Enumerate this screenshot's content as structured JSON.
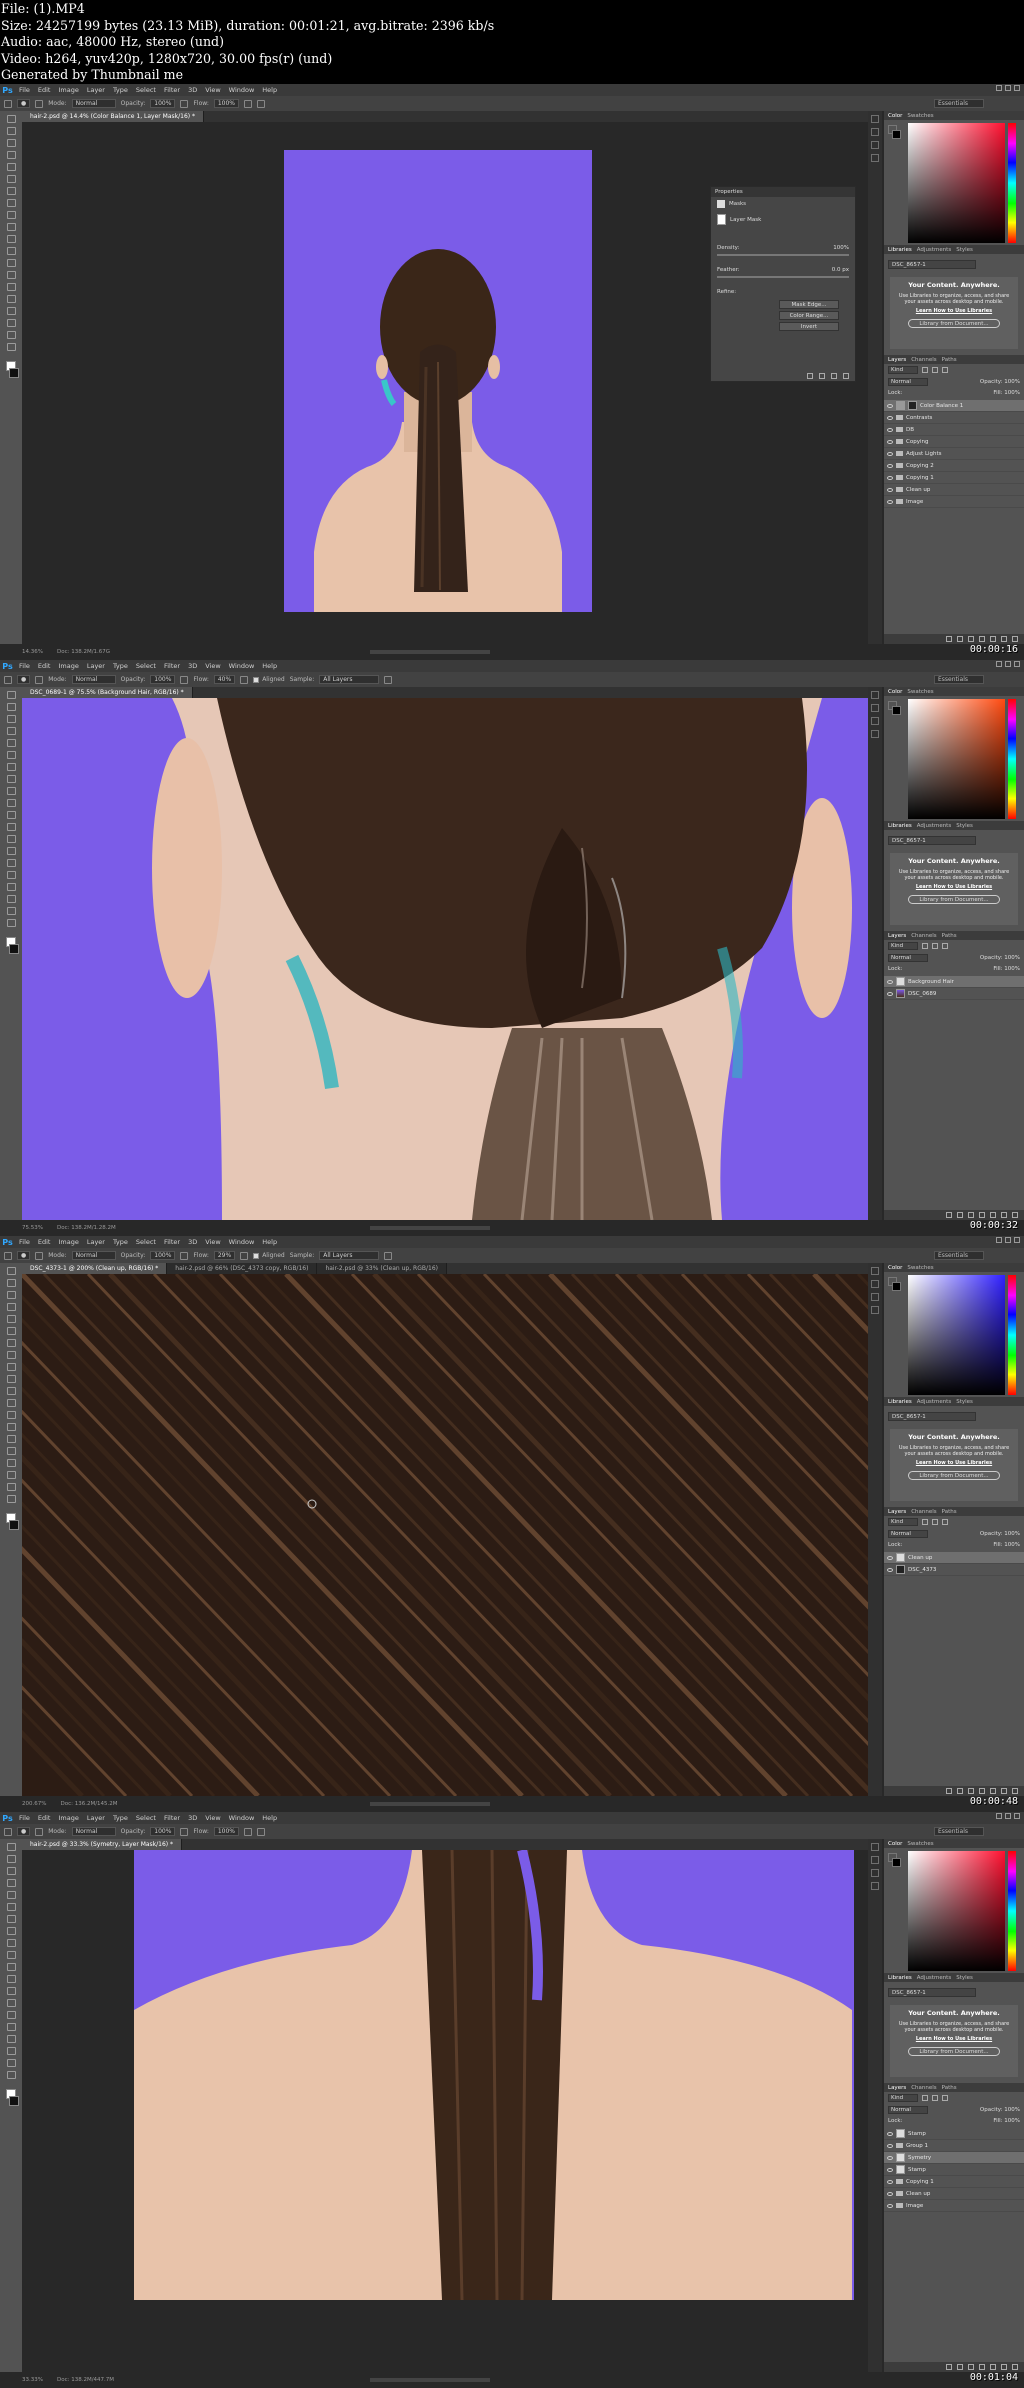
{
  "header": {
    "file": "File:  (1).MP4",
    "size": "Size: 24257199 bytes (23.13 MiB), duration: 00:01:21, avg.bitrate: 2396 kb/s",
    "audio": "Audio: aac, 48000 Hz, stereo (und)",
    "video": "Video: h264, yuv420p, 1280x720, 30.00 fps(r) (und)",
    "generated": "Generated by Thumbnail me"
  },
  "app": {
    "logo": "Ps",
    "menu": [
      "File",
      "Edit",
      "Image",
      "Layer",
      "Type",
      "Select",
      "Filter",
      "3D",
      "View",
      "Window",
      "Help"
    ],
    "workspace": "Essentials"
  },
  "frames": [
    {
      "timecode": "00:00:16",
      "tabs": [
        "hair-2.psd @ 14.4% (Color Balance 1, Layer Mask/16) *"
      ],
      "options": {
        "mode_label": "Mode:",
        "mode": "Normal",
        "opacity_label": "Opacity:",
        "opacity": "100%",
        "flow_label": "Flow:",
        "flow": "100%"
      },
      "status": [
        "14.36%",
        "Doc: 138.2M/1.67G"
      ],
      "color_tabs": [
        "Color",
        "Swatches"
      ],
      "libraries": {
        "tabs": [
          "Libraries",
          "Adjustments",
          "Styles"
        ],
        "selected": "DSC_8657-1",
        "title": "Your Content. Anywhere.",
        "text": "Use Libraries to organize, access, and share your assets across desktop and mobile.",
        "link": "Learn How to Use Libraries",
        "button": "Library from Document..."
      },
      "layer_tabs": [
        "Layers",
        "Channels",
        "Paths"
      ],
      "kind": "Kind",
      "blend": "Normal",
      "opacity": "Opacity: 100%",
      "fill": "Fill: 100%",
      "layers": [
        {
          "name": "Color Balance 1",
          "type": "adj",
          "selected": true
        },
        {
          "name": "Contrasts",
          "type": "group"
        },
        {
          "name": "DB",
          "type": "group"
        },
        {
          "name": "Copying",
          "type": "group"
        },
        {
          "name": "Adjust Lights",
          "type": "group"
        },
        {
          "name": "Copying 2",
          "type": "group"
        },
        {
          "name": "Copying 1",
          "type": "group"
        },
        {
          "name": "Clean up",
          "type": "group"
        },
        {
          "name": "Image",
          "type": "group"
        }
      ],
      "properties": {
        "title": "Properties",
        "masks": "Masks",
        "layer_mask": "Layer Mask",
        "density_label": "Density:",
        "density": "100%",
        "feather_label": "Feather:",
        "feather": "0.0 px",
        "refine_label": "Refine:",
        "buttons": [
          "Mask Edge...",
          "Color Range...",
          "Invert"
        ]
      }
    },
    {
      "timecode": "00:00:32",
      "tabs": [
        "DSC_0689-1 @ 75.5% (Background Hair, RGB/16) *"
      ],
      "options": {
        "mode_label": "Mode:",
        "mode": "Normal",
        "opacity_label": "Opacity:",
        "opacity": "100%",
        "flow_label": "Flow:",
        "flow": "40%",
        "aligned": "Aligned",
        "sample_label": "Sample:",
        "sample": "All Layers"
      },
      "status": [
        "75.53%",
        "Doc: 138.2M/1.28.2M"
      ],
      "color_tabs": [
        "Color",
        "Swatches"
      ],
      "libraries": {
        "tabs": [
          "Libraries",
          "Adjustments",
          "Styles"
        ],
        "selected": "DSC_8657-1",
        "title": "Your Content. Anywhere.",
        "text": "Use Libraries to organize, access, and share your assets across desktop and mobile.",
        "link": "Learn How to Use Libraries",
        "button": "Library from Document..."
      },
      "layer_tabs": [
        "Layers",
        "Channels",
        "Paths"
      ],
      "kind": "Kind",
      "blend": "Normal",
      "opacity": "Opacity: 100%",
      "fill": "Fill: 100%",
      "layers": [
        {
          "name": "Background Hair",
          "type": "empty",
          "selected": true
        },
        {
          "name": "DSC_0689",
          "type": "img"
        }
      ]
    },
    {
      "timecode": "00:00:48",
      "tabs": [
        "DSC_4373-1 @ 200% (Clean up, RGB/16) *",
        "hair-2.psd @ 66% (DSC_4373 copy, RGB/16)",
        "hair-2.psd @ 33% (Clean up, RGB/16)"
      ],
      "options": {
        "mode_label": "Mode:",
        "mode": "Normal",
        "opacity_label": "Opacity:",
        "opacity": "100%",
        "flow_label": "Flow:",
        "flow": "29%",
        "aligned": "Aligned",
        "sample_label": "Sample:",
        "sample": "All Layers"
      },
      "status": [
        "200.67%",
        "Doc: 136.2M/145.2M"
      ],
      "color_tabs": [
        "Color",
        "Swatches"
      ],
      "libraries": {
        "tabs": [
          "Libraries",
          "Adjustments",
          "Styles"
        ],
        "selected": "DSC_8657-1",
        "title": "Your Content. Anywhere.",
        "text": "Use Libraries to organize, access, and share your assets across desktop and mobile.",
        "link": "Learn How to Use Libraries",
        "button": "Library from Document..."
      },
      "layer_tabs": [
        "Layers",
        "Channels",
        "Paths"
      ],
      "kind": "Kind",
      "blend": "Normal",
      "opacity": "Opacity: 100%",
      "fill": "Fill: 100%",
      "layers": [
        {
          "name": "Clean up",
          "type": "empty",
          "selected": true
        },
        {
          "name": "DSC_4373",
          "type": "dark"
        }
      ]
    },
    {
      "timecode": "00:01:04",
      "tabs": [
        "hair-2.psd @ 33.3% (Symetry, Layer Mask/16) *"
      ],
      "options": {
        "mode_label": "Mode:",
        "mode": "Normal",
        "opacity_label": "Opacity:",
        "opacity": "100%",
        "flow_label": "Flow:",
        "flow": "100%"
      },
      "status": [
        "33.33%",
        "Doc: 138.2M/447.7M"
      ],
      "color_tabs": [
        "Color",
        "Swatches"
      ],
      "libraries": {
        "tabs": [
          "Libraries",
          "Adjustments",
          "Styles"
        ],
        "selected": "DSC_8657-1",
        "title": "Your Content. Anywhere.",
        "text": "Use Libraries to organize, access, and share your assets across desktop and mobile.",
        "link": "Learn How to Use Libraries",
        "button": "Library from Document..."
      },
      "layer_tabs": [
        "Layers",
        "Channels",
        "Paths"
      ],
      "kind": "Kind",
      "blend": "Normal",
      "opacity": "Opacity: 100%",
      "fill": "Fill: 100%",
      "layers": [
        {
          "name": "Stamp",
          "type": "empty"
        },
        {
          "name": "Group 1",
          "type": "group"
        },
        {
          "name": "Symetry",
          "type": "empty",
          "selected": true
        },
        {
          "name": "Stamp",
          "type": "empty"
        },
        {
          "name": "Copying 1",
          "type": "group"
        },
        {
          "name": "Clean up",
          "type": "group"
        },
        {
          "name": "Image",
          "type": "group"
        }
      ]
    }
  ],
  "colors": {
    "purple_bg": "#7b5ce8",
    "hair_dark": "#2c1c14",
    "skin": "#e8c3aa",
    "ps_blue": "#31a8ff"
  }
}
